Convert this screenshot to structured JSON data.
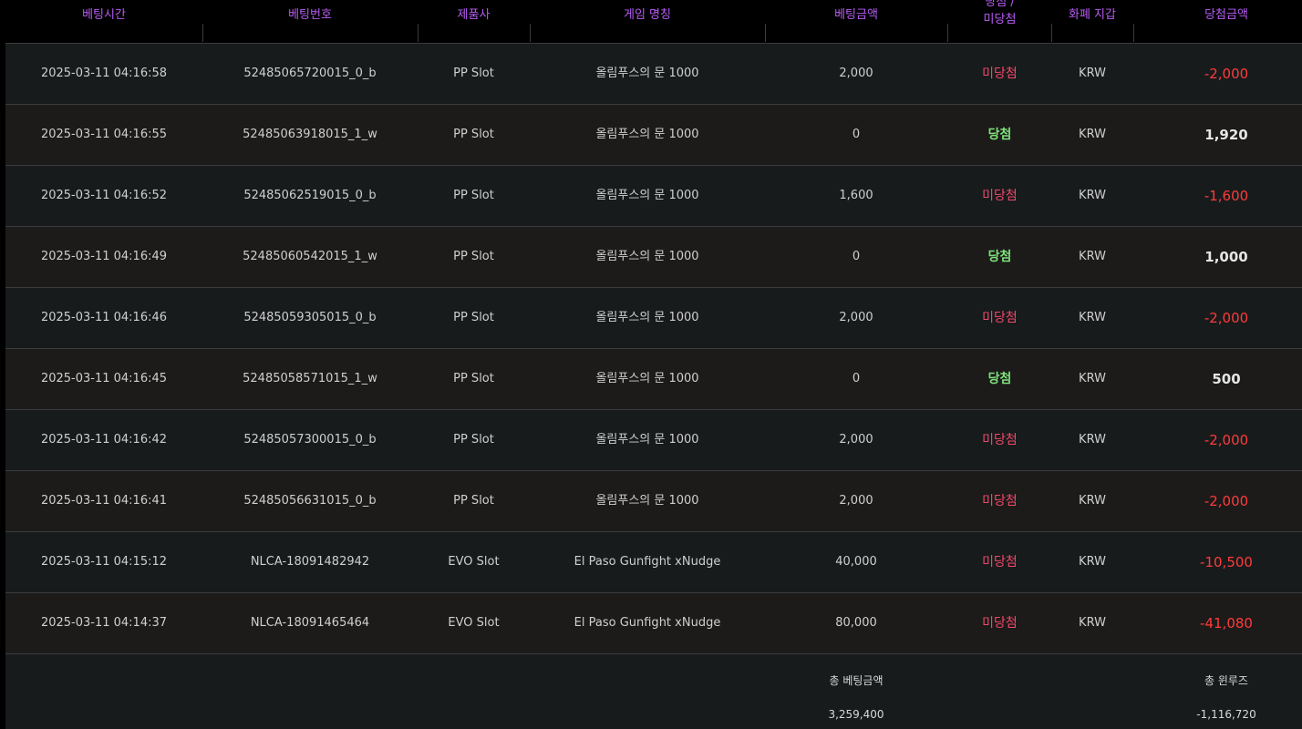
{
  "table": {
    "headers": {
      "time": "베팅시간",
      "bet_id": "베팅번호",
      "provider": "제품사",
      "game": "게임 명칭",
      "bet_amount": "베팅금액",
      "result_line1": "당첨 /",
      "result_line2": "미당첨",
      "currency": "화폐 지갑",
      "win_amount": "당첨금액"
    },
    "rows": [
      {
        "time": "2025-03-11 04:16:58",
        "bet_id": "52485065720015_0_b",
        "provider": "PP Slot",
        "game": "올림푸스의 문 1000",
        "bet_amount": "2,000",
        "result": "미당첨",
        "currency": "KRW",
        "win_amount": "-2,000"
      },
      {
        "time": "2025-03-11 04:16:55",
        "bet_id": "52485063918015_1_w",
        "provider": "PP Slot",
        "game": "올림푸스의 문 1000",
        "bet_amount": "0",
        "result": "당첨",
        "currency": "KRW",
        "win_amount": "1,920"
      },
      {
        "time": "2025-03-11 04:16:52",
        "bet_id": "52485062519015_0_b",
        "provider": "PP Slot",
        "game": "올림푸스의 문 1000",
        "bet_amount": "1,600",
        "result": "미당첨",
        "currency": "KRW",
        "win_amount": "-1,600"
      },
      {
        "time": "2025-03-11 04:16:49",
        "bet_id": "52485060542015_1_w",
        "provider": "PP Slot",
        "game": "올림푸스의 문 1000",
        "bet_amount": "0",
        "result": "당첨",
        "currency": "KRW",
        "win_amount": "1,000"
      },
      {
        "time": "2025-03-11 04:16:46",
        "bet_id": "52485059305015_0_b",
        "provider": "PP Slot",
        "game": "올림푸스의 문 1000",
        "bet_amount": "2,000",
        "result": "미당첨",
        "currency": "KRW",
        "win_amount": "-2,000"
      },
      {
        "time": "2025-03-11 04:16:45",
        "bet_id": "52485058571015_1_w",
        "provider": "PP Slot",
        "game": "올림푸스의 문 1000",
        "bet_amount": "0",
        "result": "당첨",
        "currency": "KRW",
        "win_amount": "500"
      },
      {
        "time": "2025-03-11 04:16:42",
        "bet_id": "52485057300015_0_b",
        "provider": "PP Slot",
        "game": "올림푸스의 문 1000",
        "bet_amount": "2,000",
        "result": "미당첨",
        "currency": "KRW",
        "win_amount": "-2,000"
      },
      {
        "time": "2025-03-11 04:16:41",
        "bet_id": "52485056631015_0_b",
        "provider": "PP Slot",
        "game": "올림푸스의 문 1000",
        "bet_amount": "2,000",
        "result": "미당첨",
        "currency": "KRW",
        "win_amount": "-2,000"
      },
      {
        "time": "2025-03-11 04:15:12",
        "bet_id": "NLCA-18091482942",
        "provider": "EVO Slot",
        "game": "El Paso Gunfight xNudge",
        "bet_amount": "40,000",
        "result": "미당첨",
        "currency": "KRW",
        "win_amount": "-10,500"
      },
      {
        "time": "2025-03-11 04:14:37",
        "bet_id": "NLCA-18091465464",
        "provider": "EVO Slot",
        "game": "El Paso Gunfight xNudge",
        "bet_amount": "80,000",
        "result": "미당첨",
        "currency": "KRW",
        "win_amount": "-41,080"
      }
    ],
    "footer": {
      "total_bet_label": "총 베팅금액",
      "total_bet_value": "3,259,400",
      "total_winloss_label": "총 윈루즈",
      "total_winloss_value": "-1,116,720"
    }
  },
  "colors": {
    "header_text": "#b65cf2",
    "lose_text": "#f0496a",
    "win_text": "#7fe07a",
    "negative_amount": "#ff3b3b"
  }
}
